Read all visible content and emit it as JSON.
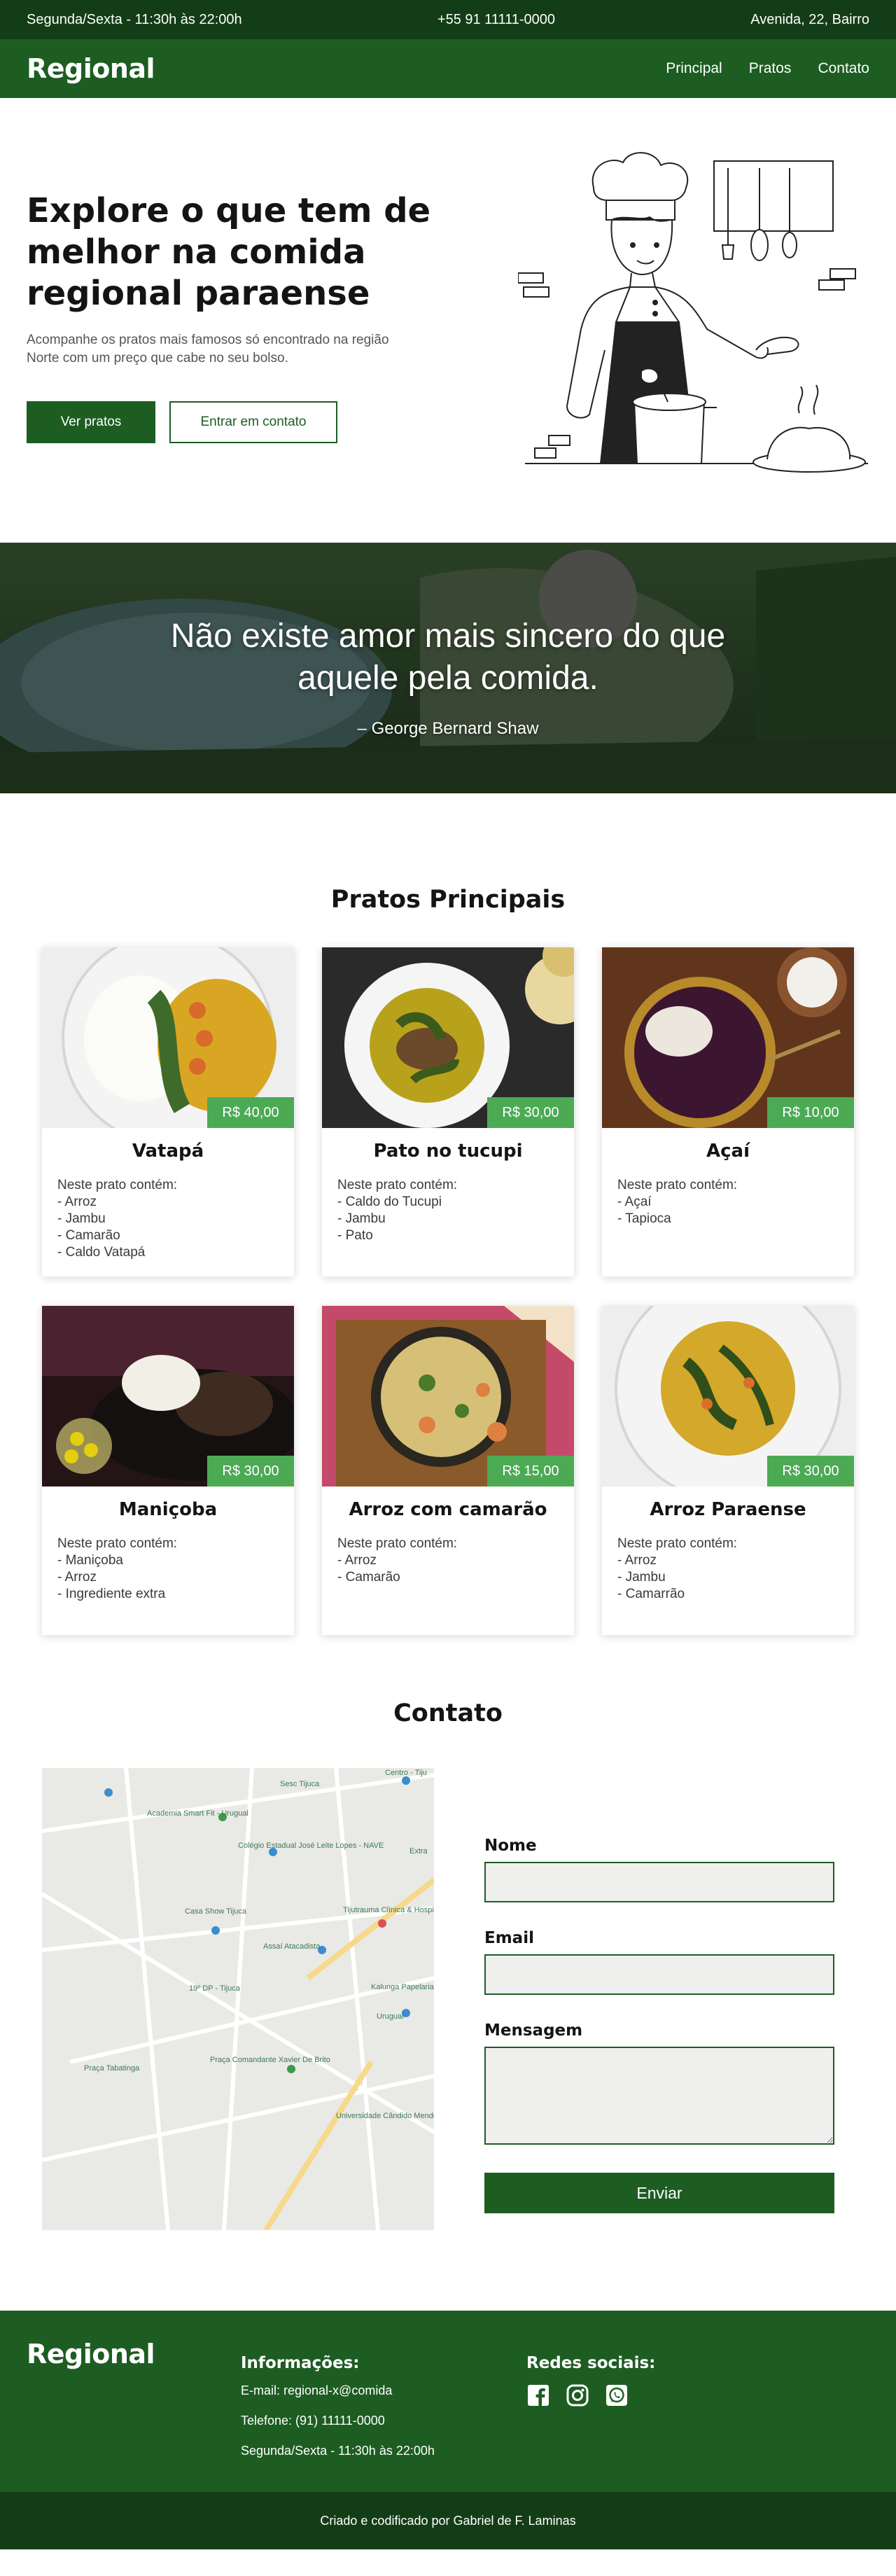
{
  "topbar": {
    "hours": "Segunda/Sexta - 11:30h às 22:00h",
    "phone": "+55 91 11111-0000",
    "address": "Avenida, 22, Bairro"
  },
  "navbar": {
    "brand": "Regional",
    "links": [
      "Principal",
      "Pratos",
      "Contato"
    ]
  },
  "hero": {
    "title": "Explore o que tem de melhor na comida regional paraense",
    "subtitle": "Acompanhe os pratos mais famosos só encontrado na região Norte com um preço que cabe no seu bolso.",
    "primary_button": "Ver pratos",
    "secondary_button": "Entrar em contato"
  },
  "quote": {
    "text": "Não existe amor mais sincero do que aquele pela comida.",
    "author": "– George Bernard Shaw"
  },
  "dishes": {
    "title": "Pratos Principais",
    "intro": "Neste prato contém:",
    "items": [
      {
        "name": "Vatapá",
        "price": "R$ 40,00",
        "ingredients": [
          "- Arroz",
          "- Jambu",
          "- Camarão",
          "- Caldo Vatapá"
        ]
      },
      {
        "name": "Pato no tucupi",
        "price": "R$ 30,00",
        "ingredients": [
          "- Caldo do Tucupi",
          "- Jambu",
          "- Pato"
        ]
      },
      {
        "name": "Açaí",
        "price": "R$ 10,00",
        "ingredients": [
          "- Açaí",
          "- Tapioca"
        ]
      },
      {
        "name": "Maniçoba",
        "price": "R$ 30,00",
        "ingredients": [
          "- Maniçoba",
          "- Arroz",
          "- Ingrediente extra"
        ]
      },
      {
        "name": "Arroz com camarão",
        "price": "R$ 15,00",
        "ingredients": [
          "- Arroz",
          "- Camarão"
        ]
      },
      {
        "name": "Arroz Paraense",
        "price": "R$ 30,00",
        "ingredients": [
          "- Arroz",
          "- Jambu",
          "- Camarrão"
        ]
      }
    ]
  },
  "contact": {
    "title": "Contato",
    "name_label": "Nome",
    "email_label": "Email",
    "message_label": "Mensagem",
    "send_button": "Enviar",
    "map_labels": [
      "Academia Smart Fit - Urugual",
      "Colégio Estadual José Leite Lopes - NAVE",
      "Casa Show Tijuca",
      "Assaí Atacadista",
      "Tijutrauma Clínica & Hospital",
      "19º DP - Tijuca",
      "Kalunga Papelaria e Informática",
      "Praça Comandante Xavier De Brito",
      "Uruguai",
      "Universidade Cândido Mendes Tijuca",
      "Sesc Tijuca",
      "Centro - Tiju",
      "Extra",
      "Praça Tabatinga"
    ]
  },
  "footer": {
    "brand": "Regional",
    "info_heading": "Informações:",
    "email": "E-mail: regional-x@comida",
    "phone": "Telefone: (91) 11111-0000",
    "hours": "Segunda/Sexta - 11:30h às 22:00h",
    "social_heading": "Redes sociais:",
    "credits": "Criado e codificado por Gabriel de F. Laminas"
  },
  "colors": {
    "dark_green": "#133d16",
    "green": "#1d5d22",
    "price_green": "#4caa55"
  },
  "icons": [
    "chef-illustration",
    "facebook-icon",
    "instagram-icon",
    "whatsapp-icon",
    "map-pin-icon"
  ]
}
